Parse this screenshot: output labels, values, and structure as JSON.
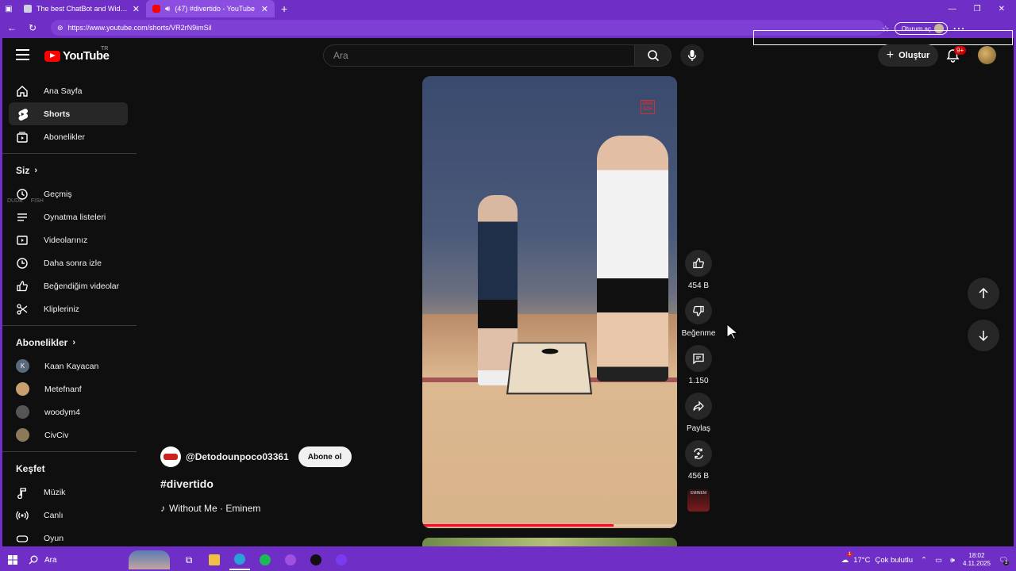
{
  "browser": {
    "tabs": [
      {
        "title": "The best ChatBot and Widgets fo",
        "favicon_color": "#cfcfe8",
        "active": false
      },
      {
        "title": "(47) #divertido - YouTube",
        "favicon_color": "#ff0000",
        "active": true
      }
    ],
    "url": "https://www.youtube.com/shorts/VR2rN9imSil",
    "signin_label": "Oturum aç",
    "accent_color": "#6f2fc7"
  },
  "masthead": {
    "logo_text": "YouTube",
    "country_code": "TR",
    "search_placeholder": "Ara",
    "create_label": "Oluştur",
    "notif_count": "9+"
  },
  "sidebar": {
    "main": [
      {
        "label": "Ana Sayfa",
        "icon": "home-icon"
      },
      {
        "label": "Shorts",
        "icon": "shorts-icon",
        "active": true
      },
      {
        "label": "Abonelikler",
        "icon": "subscriptions-icon"
      }
    ],
    "shorts_sub": [
      "DUDB",
      "FISH"
    ],
    "you_header": "Siz",
    "you": [
      {
        "label": "Geçmiş",
        "icon": "history-icon"
      },
      {
        "label": "Oynatma listeleri",
        "icon": "playlist-icon"
      },
      {
        "label": "Videolarınız",
        "icon": "your-videos-icon"
      },
      {
        "label": "Daha sonra izle",
        "icon": "watch-later-icon"
      },
      {
        "label": "Beğendiğim videolar",
        "icon": "liked-icon"
      },
      {
        "label": "Klipleriniz",
        "icon": "clips-icon"
      }
    ],
    "subs_header": "Abonelikler",
    "subs": [
      {
        "label": "Kaan Kayacan",
        "initial": "K",
        "color": "#5a6a7a"
      },
      {
        "label": "Metefnanf",
        "initial": "",
        "color": "#c8a070"
      },
      {
        "label": "woodym4",
        "initial": "",
        "color": "#555555"
      },
      {
        "label": "CivCiv",
        "initial": "",
        "color": "#8a7a5a"
      }
    ],
    "explore_header": "Keşfet",
    "explore": [
      {
        "label": "Müzik",
        "icon": "music-icon"
      },
      {
        "label": "Canlı",
        "icon": "live-icon"
      },
      {
        "label": "Oyun",
        "icon": "gaming-icon"
      }
    ]
  },
  "short": {
    "channel": "@Detodounpoco03361",
    "subscribe_label": "Abone ol",
    "title": "#divertido",
    "sound": "Without Me · Eminem",
    "watermark": "DNG SZH",
    "progress": 0.75
  },
  "actions": {
    "likes": "454 B",
    "dislike_label": "Beğenme",
    "comments": "1.150",
    "share_label": "Paylaş",
    "remix": "456 B",
    "music_thumb_label": "EMINEM"
  },
  "taskbar": {
    "search_label": "Ara",
    "weather_badge": "1",
    "temperature": "17°C",
    "weather_text": "Çok bulutlu",
    "time": "18:02",
    "date": "4.11.2025",
    "notif_count": "3"
  }
}
